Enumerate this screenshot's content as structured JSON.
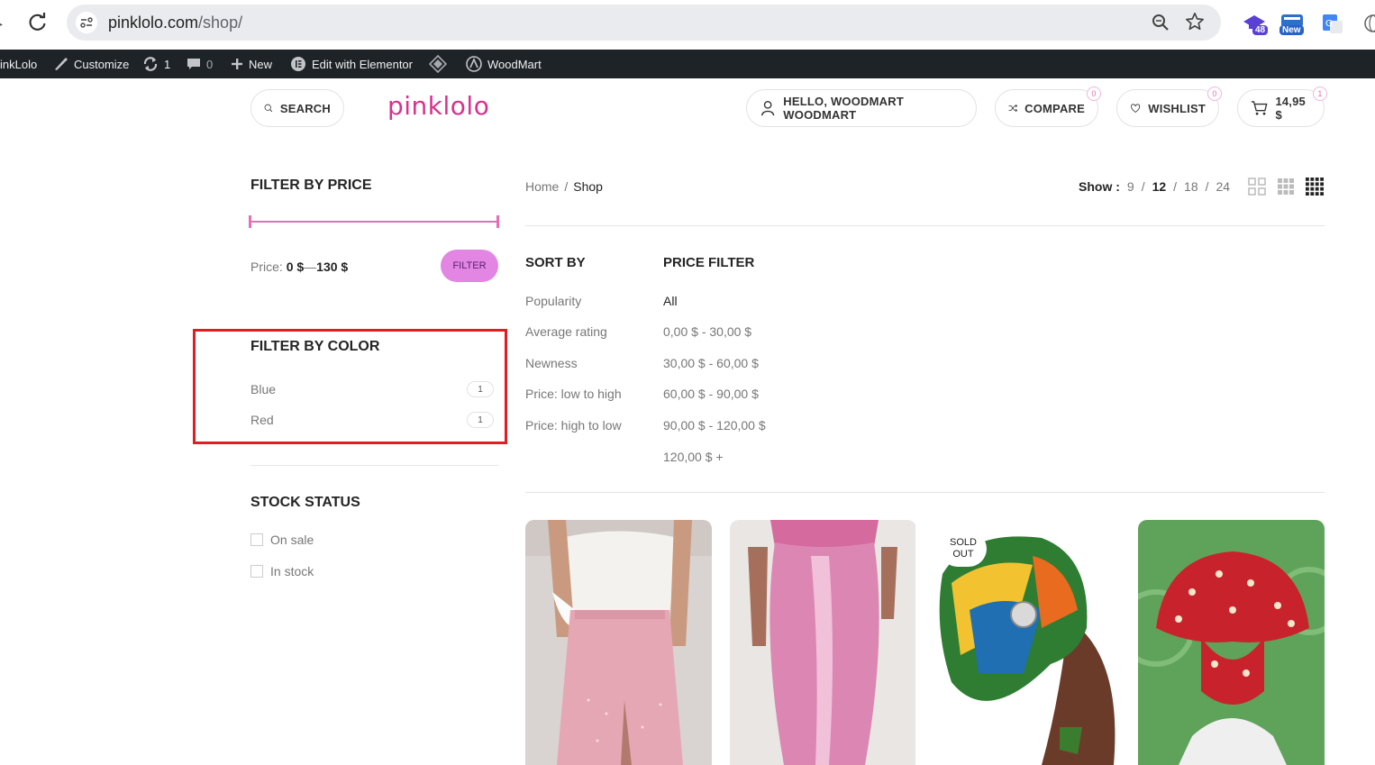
{
  "browser": {
    "url_host": "pinklolo.com",
    "url_path": "/shop/",
    "extensions": [
      {
        "name": "ext-grad-icon",
        "badge": "48"
      },
      {
        "name": "ext-new-icon",
        "badge": "New"
      },
      {
        "name": "google-translate-icon",
        "badge": ""
      },
      {
        "name": "globe-icon",
        "badge": ""
      }
    ]
  },
  "adminbar": {
    "site_name": "inkLolo",
    "customize": "Customize",
    "updates_count": "1",
    "comments_count": "0",
    "new": "New",
    "edit_elementor": "Edit with Elementor",
    "woodmart": "WoodMart"
  },
  "header": {
    "search": "SEARCH",
    "logo": "pinklolo",
    "account": "HELLO, WOODMART WOODMART",
    "compare": "COMPARE",
    "compare_count": "0",
    "wishlist": "WISHLIST",
    "wishlist_count": "0",
    "cart_total": "14,95 $",
    "cart_count": "1"
  },
  "sidebar": {
    "price_title": "FILTER BY PRICE",
    "price_label": "Price:",
    "price_min": "0 $",
    "price_sep": "—",
    "price_max": "130 $",
    "filter_button": "FILTER",
    "color_title": "FILTER BY COLOR",
    "colors": [
      {
        "label": "Blue",
        "count": "1"
      },
      {
        "label": "Red",
        "count": "1"
      }
    ],
    "stock_title": "STOCK STATUS",
    "stock": [
      {
        "label": "On sale"
      },
      {
        "label": "In stock"
      }
    ]
  },
  "main": {
    "breadcrumb": {
      "home": "Home",
      "sep": "/",
      "current": "Shop"
    },
    "show": {
      "label": "Show :",
      "options": [
        "9",
        "12",
        "18",
        "24"
      ],
      "separators": [
        "/",
        "/",
        "/"
      ],
      "active": "12"
    },
    "sort_title": "SORT BY",
    "sort_options": [
      "Popularity",
      "Average rating",
      "Newness",
      "Price: low to high",
      "Price: high to low"
    ],
    "price_filter_title": "PRICE FILTER",
    "price_filter_options": [
      "All",
      "0,00 $ - 30,00 $",
      "30,00 $ - 60,00 $",
      "60,00 $ - 90,00 $",
      "90,00 $ - 120,00 $",
      "120,00 $ +"
    ],
    "sold_out": "SOLD OUT"
  },
  "colors": {
    "accent": "#e46fb7",
    "logo": "#d6338e",
    "highlight": "#e31b23",
    "adminbar": "#1d2327"
  }
}
